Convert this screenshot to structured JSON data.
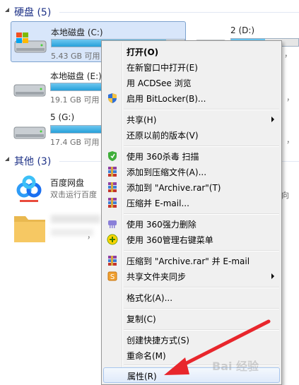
{
  "groups": {
    "drives": {
      "title": "硬盘 (5)"
    },
    "other": {
      "title": "其他 (3)"
    }
  },
  "drives": [
    {
      "name": "本地磁盘 (C:)",
      "free": "5.43 GB 可用",
      "usage": 0.86
    },
    {
      "name": "本地磁盘 (E:)",
      "free": "19.1 GB 可用",
      "usage": 0.76
    },
    {
      "name": "5 (G:)",
      "free": "17.4 GB 可用",
      "usage": 0.78
    },
    {
      "name": "2 (D:)",
      "free": "",
      "usage": 0.5
    }
  ],
  "peek": {
    "d_free_tail": "，",
    "e_tail": "，",
    "g_tail": "，",
    "app_tail": "向",
    "folder_tail": "，"
  },
  "apps": [
    {
      "name": "百度网盘",
      "desc": "双击运行百度"
    }
  ],
  "menu": {
    "items": [
      {
        "label": "打开(O)",
        "bold": true
      },
      {
        "label": "在新窗口中打开(E)"
      },
      {
        "label": "用 ACDSee 浏览"
      },
      {
        "label": "启用 BitLocker(B)...",
        "icon": "shield-icon"
      },
      {
        "label": "共享(H)",
        "submenu": true
      },
      {
        "label": "还原以前的版本(V)"
      },
      {
        "label": "使用 360杀毒 扫描",
        "icon": "360-antivirus-icon"
      },
      {
        "label": "添加到压缩文件(A)...",
        "icon": "winrar-icon"
      },
      {
        "label": "添加到 \"Archive.rar\"(T)",
        "icon": "winrar-icon"
      },
      {
        "label": "压缩并 E-mail...",
        "icon": "winrar-icon"
      },
      {
        "label": "使用 360强力删除",
        "icon": "360-shredder-icon"
      },
      {
        "label": "使用 360管理右键菜单",
        "icon": "360-menu-manager-icon"
      },
      {
        "label": "压缩到 \"Archive.rar\" 并 E-mail",
        "icon": "winrar-icon"
      },
      {
        "label": "共享文件夹同步",
        "icon": "sync-icon",
        "submenu": true
      },
      {
        "label": "格式化(A)..."
      },
      {
        "label": "复制(C)"
      },
      {
        "label": "创建快捷方式(S)"
      },
      {
        "label": "重命名(M)"
      },
      {
        "label": "属性(R)",
        "hover": true
      }
    ]
  },
  "colors": {
    "accent": "#1e3287",
    "bar": "#26a0da",
    "hover": "#dfeafa",
    "arrow": "#e8262c"
  },
  "watermark": "Bai 经验"
}
